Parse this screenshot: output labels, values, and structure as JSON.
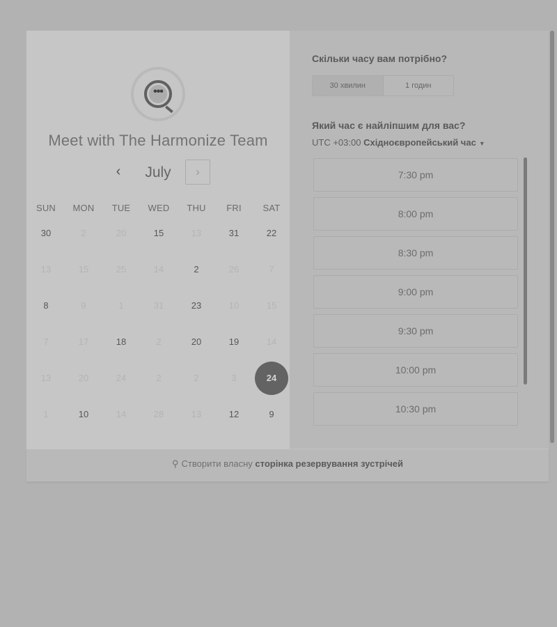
{
  "calendar": {
    "title": "Meet with The Harmonize Team",
    "month": "July",
    "prev_icon": "‹",
    "next_icon": "›",
    "weekdays": [
      "SUN",
      "MON",
      "TUE",
      "WED",
      "THU",
      "FRI",
      "SAT"
    ],
    "weeks": [
      [
        {
          "d": "30",
          "s": "a"
        },
        {
          "d": "2",
          "s": "u"
        },
        {
          "d": "20",
          "s": "u"
        },
        {
          "d": "15",
          "s": "a"
        },
        {
          "d": "13",
          "s": "u"
        },
        {
          "d": "31",
          "s": "a"
        },
        {
          "d": "22",
          "s": "a"
        }
      ],
      [
        {
          "d": "13",
          "s": "u"
        },
        {
          "d": "15",
          "s": "u"
        },
        {
          "d": "25",
          "s": "u"
        },
        {
          "d": "14",
          "s": "u"
        },
        {
          "d": "2",
          "s": "a"
        },
        {
          "d": "26",
          "s": "u"
        },
        {
          "d": "7",
          "s": "u"
        }
      ],
      [
        {
          "d": "8",
          "s": "a"
        },
        {
          "d": "9",
          "s": "u"
        },
        {
          "d": "1",
          "s": "u"
        },
        {
          "d": "31",
          "s": "u"
        },
        {
          "d": "23",
          "s": "a"
        },
        {
          "d": "10",
          "s": "u"
        },
        {
          "d": "15",
          "s": "u"
        }
      ],
      [
        {
          "d": "7",
          "s": "u"
        },
        {
          "d": "17",
          "s": "u"
        },
        {
          "d": "18",
          "s": "a"
        },
        {
          "d": "2",
          "s": "u"
        },
        {
          "d": "20",
          "s": "a"
        },
        {
          "d": "19",
          "s": "a"
        },
        {
          "d": "14",
          "s": "u"
        }
      ],
      [
        {
          "d": "13",
          "s": "u"
        },
        {
          "d": "20",
          "s": "u"
        },
        {
          "d": "24",
          "s": "u"
        },
        {
          "d": "2",
          "s": "u"
        },
        {
          "d": "2",
          "s": "u"
        },
        {
          "d": "3",
          "s": "u"
        },
        {
          "d": "24",
          "s": "sel"
        }
      ],
      [
        {
          "d": "1",
          "s": "u"
        },
        {
          "d": "10",
          "s": "a"
        },
        {
          "d": "14",
          "s": "u"
        },
        {
          "d": "28",
          "s": "u"
        },
        {
          "d": "13",
          "s": "u"
        },
        {
          "d": "12",
          "s": "a"
        },
        {
          "d": "9",
          "s": "a"
        }
      ]
    ]
  },
  "duration": {
    "question": "Скільки часу вам потрібно?",
    "options": [
      "30 хвилин",
      "1 годин"
    ],
    "selected": "30 хвилин"
  },
  "time": {
    "question": "Який час є найліпшим для вас?",
    "timezone_offset": "UTC +03:00",
    "timezone_name": "Східноєвропейський час",
    "slots": [
      "7:30 pm",
      "8:00 pm",
      "8:30 pm",
      "9:00 pm",
      "9:30 pm",
      "10:00 pm",
      "10:30 pm"
    ]
  },
  "footer": {
    "prefix": "Створити власну",
    "link": "сторінка резервування зустрічей"
  },
  "colors": {
    "background": "#b2b2b2",
    "selected_day": "#636363"
  }
}
